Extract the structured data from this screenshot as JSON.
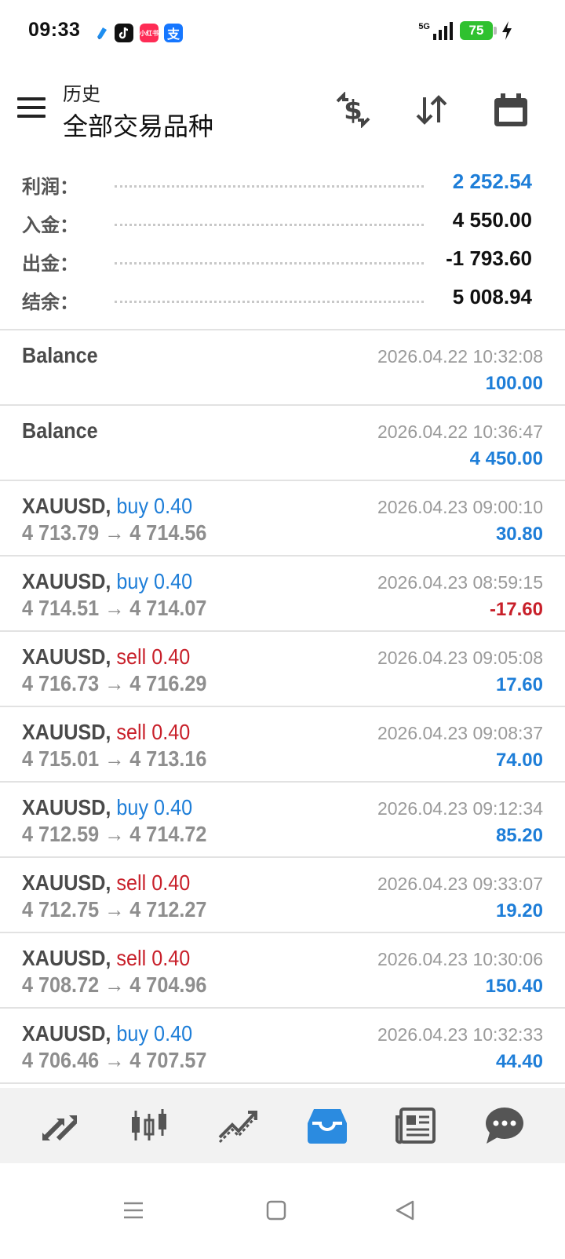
{
  "status_bar": {
    "time": "09:33",
    "network": "5G",
    "battery": "75",
    "apps": [
      "app-blue-icon",
      "tiktok-icon",
      "xiaohongshu-icon",
      "alipay-icon"
    ],
    "xhs_label": "小红书",
    "alipay_label": "支"
  },
  "toolbar": {
    "subtitle": "历史",
    "title": "全部交易品种"
  },
  "summary": [
    {
      "label": "利润：",
      "value": "2 252.54",
      "accent": "#1e7ed8"
    },
    {
      "label": "入金：",
      "value": "4 550.00"
    },
    {
      "label": "出金：",
      "value": "-1 793.60"
    },
    {
      "label": "结余：",
      "value": "5 008.94"
    }
  ],
  "deals": [
    {
      "symbol": "Balance",
      "side": "",
      "volume": "",
      "prices": "",
      "time": "2026.04.22 10:32:08",
      "profit": "100.00"
    },
    {
      "symbol": "Balance",
      "side": "",
      "volume": "",
      "prices": "",
      "time": "2026.04.22 10:36:47",
      "profit": "4 450.00"
    },
    {
      "symbol": "XAUUSD,",
      "side": "buy",
      "volume": "0.40",
      "prices": "4 713.79 → 4 714.56",
      "time": "2026.04.23 09:00:10",
      "profit": "30.80"
    },
    {
      "symbol": "XAUUSD,",
      "side": "buy",
      "volume": "0.40",
      "prices": "4 714.51 → 4 714.07",
      "time": "2026.04.23 08:59:15",
      "profit": "-17.60"
    },
    {
      "symbol": "XAUUSD,",
      "side": "sell",
      "volume": "0.40",
      "prices": "4 716.73 → 4 716.29",
      "time": "2026.04.23 09:05:08",
      "profit": "17.60"
    },
    {
      "symbol": "XAUUSD,",
      "side": "sell",
      "volume": "0.40",
      "prices": "4 715.01 → 4 713.16",
      "time": "2026.04.23 09:08:37",
      "profit": "74.00"
    },
    {
      "symbol": "XAUUSD,",
      "side": "buy",
      "volume": "0.40",
      "prices": "4 712.59 → 4 714.72",
      "time": "2026.04.23 09:12:34",
      "profit": "85.20"
    },
    {
      "symbol": "XAUUSD,",
      "side": "sell",
      "volume": "0.40",
      "prices": "4 712.75 → 4 712.27",
      "time": "2026.04.23 09:33:07",
      "profit": "19.20"
    },
    {
      "symbol": "XAUUSD,",
      "side": "sell",
      "volume": "0.40",
      "prices": "4 708.72 → 4 704.96",
      "time": "2026.04.23 10:30:06",
      "profit": "150.40"
    },
    {
      "symbol": "XAUUSD,",
      "side": "buy",
      "volume": "0.40",
      "prices": "4 706.46 → 4 707.57",
      "time": "2026.04.23 10:32:33",
      "profit": "44.40"
    }
  ],
  "colors": {
    "buy": "#1e7ed8",
    "sell": "#c8202a",
    "profit_positive": "#1e7ed8",
    "profit_negative": "#c8202a",
    "active_tab": "#2b8be0"
  },
  "tabs": [
    {
      "icon": "quotes-icon",
      "active": false
    },
    {
      "icon": "chart-icon",
      "active": false
    },
    {
      "icon": "trade-icon",
      "active": false
    },
    {
      "icon": "history-icon",
      "active": true
    },
    {
      "icon": "news-icon",
      "active": false
    },
    {
      "icon": "chat-icon",
      "active": false
    }
  ],
  "nav": [
    "recents-nav-icon",
    "home-nav-icon",
    "back-nav-icon"
  ]
}
